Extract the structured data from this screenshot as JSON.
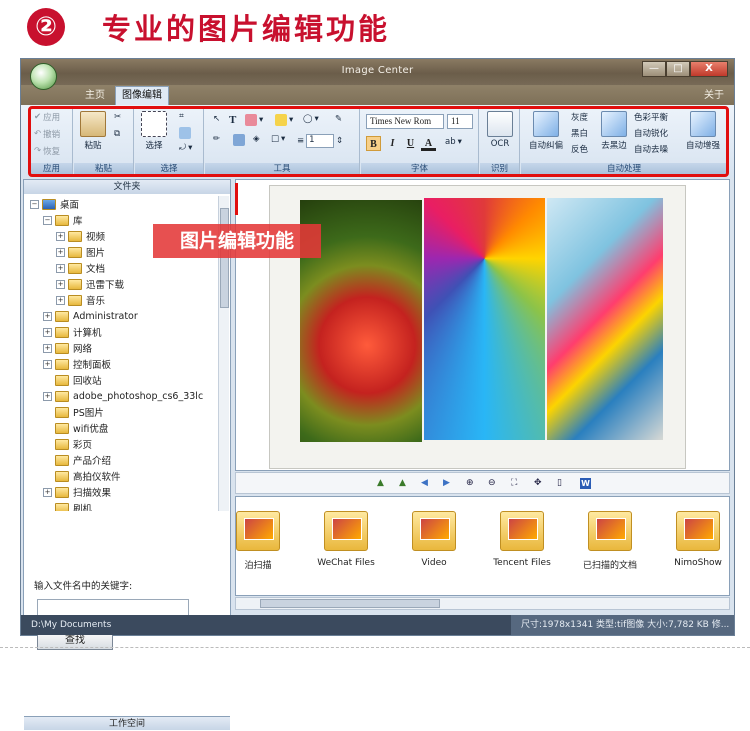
{
  "headline": {
    "number": "②",
    "text": "专业的图片编辑功能"
  },
  "window": {
    "title": "Image Center",
    "buttons": {
      "minimize": "—",
      "maximize": "□",
      "close": "X"
    }
  },
  "tabs": {
    "home": "主页",
    "edit": "图像编辑",
    "about": "关于"
  },
  "ribbon": {
    "groups": {
      "apply": "应用",
      "paste": "粘贴",
      "select": "选择",
      "tools": "工具",
      "font": "字体",
      "ocr": "识别",
      "auto": "自动处理"
    },
    "apply": {
      "apply": "应用",
      "undo": "撤销",
      "redo": "恢复"
    },
    "paste": {
      "label": "粘贴"
    },
    "select": {
      "label": "选择"
    },
    "tools": {
      "line_width": "1"
    },
    "font": {
      "family": "Times New Rom",
      "size": "11",
      "bold": "B",
      "italic": "I",
      "underline": "U",
      "color": "A"
    },
    "ocr": {
      "label": "OCR"
    },
    "auto": {
      "deskew": "自动纠偏",
      "gray": "灰度",
      "bw": "黑白",
      "invert": "反色",
      "remove_border": "去黑边",
      "color_balance": "色彩平衡",
      "sharpen": "自动锐化",
      "denoise": "自动去噪",
      "enhance": "自动增强"
    }
  },
  "left_panel": {
    "header": "文件夹",
    "tree": [
      {
        "label": "桌面",
        "level": 0,
        "expander": "−"
      },
      {
        "label": "库",
        "level": 1,
        "expander": "−"
      },
      {
        "label": "视频",
        "level": 2,
        "expander": "+"
      },
      {
        "label": "图片",
        "level": 2,
        "expander": "+"
      },
      {
        "label": "文档",
        "level": 2,
        "expander": "+"
      },
      {
        "label": "迅雷下载",
        "level": 2,
        "expander": "+"
      },
      {
        "label": "音乐",
        "level": 2,
        "expander": "+"
      },
      {
        "label": "Administrator",
        "level": 1,
        "expander": "+"
      },
      {
        "label": "计算机",
        "level": 1,
        "expander": "+"
      },
      {
        "label": "网络",
        "level": 1,
        "expander": "+"
      },
      {
        "label": "控制面板",
        "level": 1,
        "expander": "+"
      },
      {
        "label": "回收站",
        "level": 1,
        "expander": ""
      },
      {
        "label": "adobe_photoshop_cs6_33lc",
        "level": 1,
        "expander": "+"
      },
      {
        "label": "PS图片",
        "level": 1,
        "expander": ""
      },
      {
        "label": "wifi优盘",
        "level": 1,
        "expander": ""
      },
      {
        "label": "彩页",
        "level": 1,
        "expander": ""
      },
      {
        "label": "产品介绍",
        "level": 1,
        "expander": ""
      },
      {
        "label": "高拍仪软件",
        "level": 1,
        "expander": ""
      },
      {
        "label": "扫描效果",
        "level": 1,
        "expander": "+"
      },
      {
        "label": "刷机",
        "level": 1,
        "expander": ""
      }
    ],
    "search_label": "输入文件名中的关键字:",
    "search_value": "",
    "search_button": "查找",
    "workspace": "工作空间"
  },
  "callout": "图片编辑功能",
  "thumbnails": [
    "泊扫描",
    "WeChat Files",
    "Video",
    "Tencent Files",
    "已扫描的文档",
    "NimoShow"
  ],
  "status": {
    "path": "D:\\My Documents",
    "info": "尺寸:1978x1341 类型:tif图像 大小:7,782 KB 修..."
  }
}
